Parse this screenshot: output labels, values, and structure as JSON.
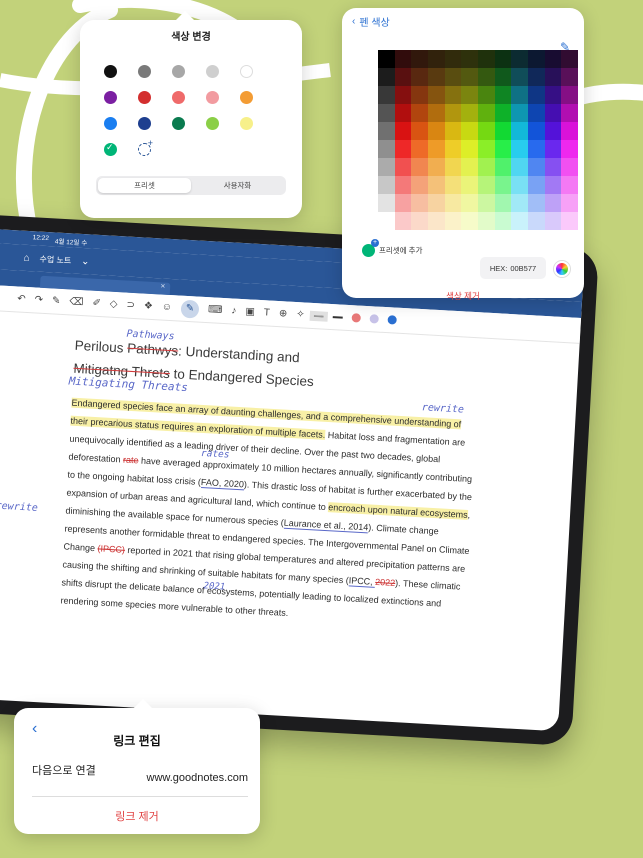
{
  "colors": {
    "background": "#c2d27a",
    "accent": "#2a6fd1",
    "toolbar": "#2a5697",
    "destructive": "#e04040",
    "highlight": "#f8f0a6"
  },
  "tablet": {
    "status": {
      "time": "12:22",
      "date": "4월 12일 수"
    },
    "nav": {
      "notebook": "수업 노트"
    },
    "toolbar_icons": [
      "undo-icon",
      "redo-icon",
      "pen-icon",
      "eraser-icon",
      "highlighter-icon",
      "shape-icon",
      "lasso-icon",
      "element-icon",
      "sticker-icon",
      "image-icon",
      "camera-icon",
      "text-icon",
      "laser-icon",
      "zoom-icon"
    ],
    "document": {
      "title_plain_1": "Perilous ",
      "title_struck_1": "Pathwys",
      "title_plain_2": ": Understanding and",
      "title_struck_2": "Mitigatng Threts",
      "title_plain_3": " to Endangered Species",
      "hw_pathways": "Pathways",
      "hw_mitigating": "Mitigating Threats",
      "hw_rewrite_1": "rewrite",
      "hw_rates": "rates",
      "hw_rewrite_2": "rewrite",
      "hw_2021": "2021",
      "p1_hl": "Endangered species face an array of daunting challenges, and a comprehensive understanding of their precarious status requires an exploration of multiple facets.",
      "p1_rest": " Habitat loss and fragmentation are unequivocally identified as a leading driver of their decline. Over the past two decades, global deforestation ",
      "p1_rate": "rate",
      "p1_rest2": " have averaged approximately 10 million hectares annually, significantly contributing to the ongoing habitat loss crisis (",
      "p1_cite1": "FAO, 2020",
      "p1_rest3": "). This drastic loss of habitat is further exacerbated by the expansion of urban areas and agricultural land, which continue to ",
      "p1_hl2": "encroach upon natural ecosystems",
      "p1_rest4": ", diminishing the available space for numerous species (",
      "p1_cite2": "Laurance et al., 2014",
      "p1_rest5": "). Climate change represents another formidable threat to endangered species. The Intergovernmental Panel on Climate Change ",
      "p1_ipcc": "(IPCC)",
      "p1_rest6": " reported in 2021 that rising global temperatures and altered precipitation patterns are causing the shifting and shrinking of suitable habitats for many species (",
      "p1_cite3a": "IPCC, ",
      "p1_cite3b": "2022",
      "p1_rest7": "). These climatic shifts disrupt the delicate balance of ecosystems, potentially leading to localized extinctions and rendering some species more vulnerable to other threats."
    }
  },
  "color_picker": {
    "title": "색상 변경",
    "swatches": [
      "#111111",
      "#7a7a7a",
      "#a7a7a7",
      "#cfcfcf",
      "#ffffff",
      "#7b1fa2",
      "#d32f2f",
      "#ef6a6a",
      "#f29ba0",
      "#f39c34",
      "#1a7ef0",
      "#1e3f8f",
      "#0a7b4f",
      "#8bcf47",
      "#f7f08a",
      "#00b577",
      "custom"
    ],
    "tab_presets": "프리셋",
    "tab_custom": "사용자화"
  },
  "pen_color": {
    "back_label": "펜 색상",
    "add_preset": "프리셋에 추가",
    "hex_label": "HEX:",
    "hex_value": "00B577",
    "remove": "색상 제거"
  },
  "link_edit": {
    "title": "링크 편집",
    "connect_label": "다음으로 연결",
    "url": "www.goodnotes.com",
    "remove": "링크 제거"
  }
}
